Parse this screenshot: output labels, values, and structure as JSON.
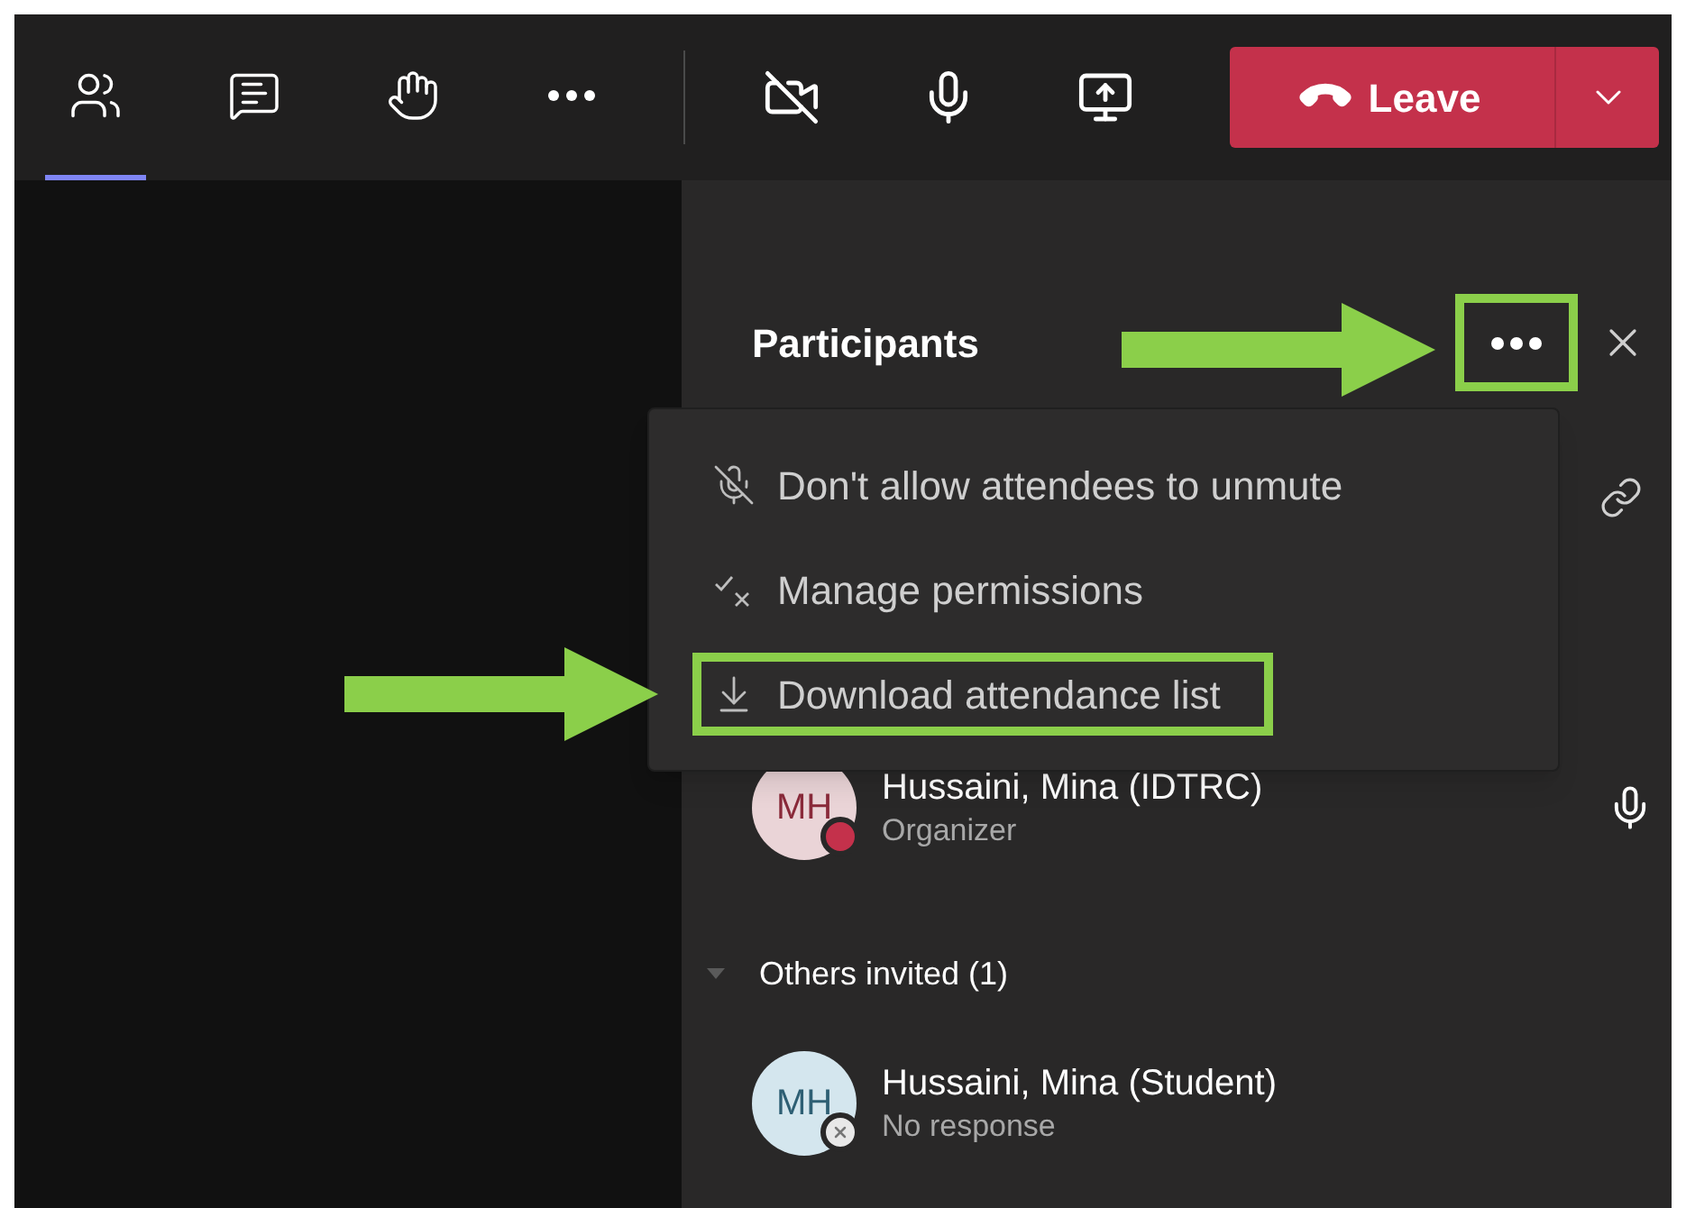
{
  "toolbar": {
    "tabs": [
      {
        "kind": "people",
        "selected": true
      },
      {
        "kind": "chat",
        "selected": false
      },
      {
        "kind": "hand",
        "selected": false
      },
      {
        "kind": "more",
        "selected": false
      }
    ],
    "controls": [
      {
        "kind": "camera-off"
      },
      {
        "kind": "mic"
      },
      {
        "kind": "share"
      }
    ],
    "leave_button": {
      "label": "Leave"
    }
  },
  "panel": {
    "title": "Participants",
    "more_highlighted": true,
    "menu": [
      {
        "kind": "mute-lock",
        "label": "Don't allow attendees to unmute",
        "highlighted": false
      },
      {
        "kind": "permissions",
        "label": "Manage permissions",
        "highlighted": false
      },
      {
        "kind": "download",
        "label": "Download attendance list",
        "highlighted": true
      }
    ],
    "participants": [
      {
        "initials": "MH",
        "name": "Hussaini, Mina (IDTRC)",
        "role": "Organizer",
        "kind": "organizer",
        "mic": true
      }
    ],
    "others": {
      "label": "Others invited (1)",
      "expanded": true,
      "participants": [
        {
          "initials": "MH",
          "name": "Hussaini, Mina (Student)",
          "role": "No response",
          "kind": "invitee",
          "mic": false
        }
      ]
    }
  }
}
